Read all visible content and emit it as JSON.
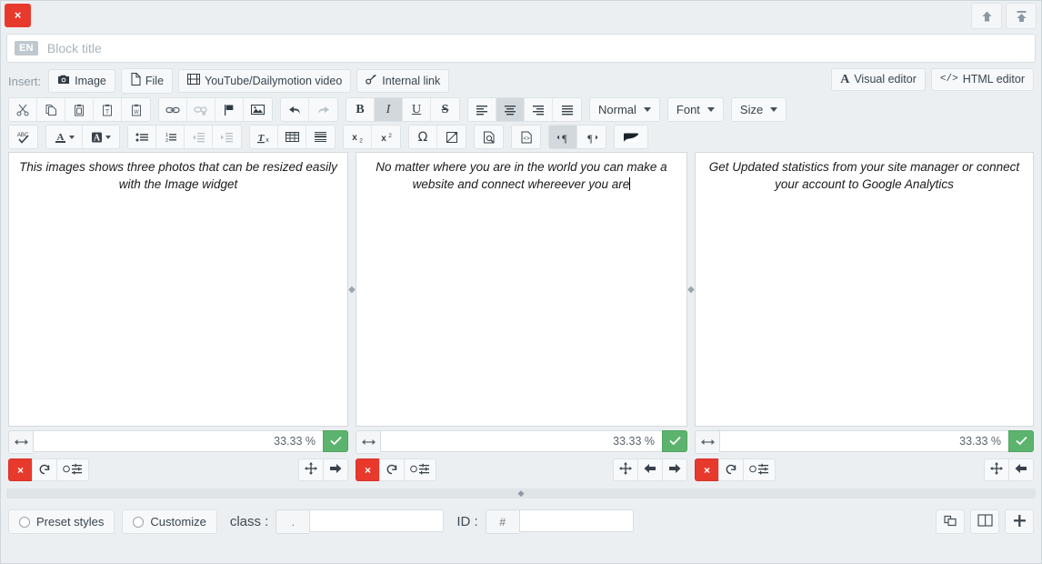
{
  "window": {
    "close_label": "×",
    "move_up_icon": "arrow-up-icon",
    "move_top_icon": "arrow-up-to-line-icon"
  },
  "title_bar": {
    "language_badge": "EN",
    "placeholder": "Block title",
    "value": ""
  },
  "insert_bar": {
    "label": "Insert:",
    "buttons": [
      {
        "label": "Image",
        "icon": "camera-icon"
      },
      {
        "label": "File",
        "icon": "file-icon"
      },
      {
        "label": "YouTube/Dailymotion video",
        "icon": "film-icon"
      },
      {
        "label": "Internal link",
        "icon": "chain-icon"
      }
    ],
    "editor_modes": [
      {
        "label": "Visual editor",
        "icon": "font-a-icon",
        "active": true
      },
      {
        "label": "HTML editor",
        "icon": "code-icon",
        "active": false
      }
    ]
  },
  "toolbar_row1": {
    "group1": [
      {
        "name": "cut",
        "icon": "scissors-icon",
        "active": false,
        "disabled": false
      },
      {
        "name": "copy",
        "icon": "copy-icon",
        "active": false,
        "disabled": false
      },
      {
        "name": "paste",
        "icon": "clipboard-icon",
        "active": false,
        "disabled": false
      },
      {
        "name": "paste-as-text",
        "icon": "clipboard-text-icon",
        "active": false,
        "disabled": false
      },
      {
        "name": "paste-from-word",
        "icon": "clipboard-word-icon",
        "active": false,
        "disabled": false
      }
    ],
    "group2": [
      {
        "name": "link",
        "icon": "link-icon",
        "active": false,
        "disabled": false
      },
      {
        "name": "unlink",
        "icon": "unlink-icon",
        "active": false,
        "disabled": true
      },
      {
        "name": "anchor",
        "icon": "flag-icon",
        "active": false,
        "disabled": false
      },
      {
        "name": "image",
        "icon": "picture-icon",
        "active": false,
        "disabled": false
      }
    ],
    "group3": [
      {
        "name": "undo",
        "icon": "undo-arrow-icon",
        "active": false,
        "disabled": false
      },
      {
        "name": "redo",
        "icon": "redo-arrow-icon",
        "active": false,
        "disabled": true
      }
    ],
    "group4": [
      {
        "name": "bold",
        "icon": "bold-icon",
        "active": false,
        "disabled": false
      },
      {
        "name": "italic",
        "icon": "italic-icon",
        "active": true,
        "disabled": false
      },
      {
        "name": "underline",
        "icon": "underline-icon",
        "active": false,
        "disabled": false
      },
      {
        "name": "strikethrough",
        "icon": "strikethrough-icon",
        "active": false,
        "disabled": false
      }
    ],
    "group5": [
      {
        "name": "align-left",
        "icon": "align-left-icon",
        "active": false,
        "disabled": false
      },
      {
        "name": "align-center",
        "icon": "align-center-icon",
        "active": true,
        "disabled": false
      },
      {
        "name": "align-right",
        "icon": "align-right-icon",
        "active": false,
        "disabled": false
      },
      {
        "name": "align-justify",
        "icon": "align-justify-icon",
        "active": false,
        "disabled": false
      }
    ],
    "selects": [
      {
        "name": "format",
        "label": "Normal"
      },
      {
        "name": "font",
        "label": "Font"
      },
      {
        "name": "size",
        "label": "Size"
      }
    ]
  },
  "toolbar_row2": {
    "group1": [
      {
        "name": "spell-check",
        "icon": "abc-check-icon",
        "active": false,
        "disabled": false
      }
    ],
    "group2": [
      {
        "name": "text-color",
        "icon": "text-color-icon",
        "active": false,
        "disabled": false
      },
      {
        "name": "background-color",
        "icon": "background-color-icon",
        "active": false,
        "disabled": false
      }
    ],
    "group3": [
      {
        "name": "bulleted-list",
        "icon": "bullet-list-icon",
        "active": false,
        "disabled": false
      },
      {
        "name": "numbered-list",
        "icon": "numbered-list-icon",
        "active": false,
        "disabled": false
      },
      {
        "name": "outdent",
        "icon": "outdent-icon",
        "active": false,
        "disabled": true
      },
      {
        "name": "indent",
        "icon": "indent-icon",
        "active": false,
        "disabled": true
      }
    ],
    "group4": [
      {
        "name": "remove-format",
        "icon": "remove-format-icon",
        "active": false,
        "disabled": false
      },
      {
        "name": "table",
        "icon": "table-icon",
        "active": false,
        "disabled": false
      },
      {
        "name": "horizontal-rule",
        "icon": "horizontal-rule-icon",
        "active": false,
        "disabled": false
      }
    ],
    "group5": [
      {
        "name": "subscript",
        "icon": "subscript-icon",
        "active": false,
        "disabled": false
      },
      {
        "name": "superscript",
        "icon": "superscript-icon",
        "active": false,
        "disabled": false
      }
    ],
    "group6": [
      {
        "name": "special-character",
        "icon": "omega-icon",
        "active": false,
        "disabled": false
      },
      {
        "name": "page-break",
        "icon": "page-break-icon",
        "active": false,
        "disabled": false
      }
    ],
    "group7": [
      {
        "name": "preview",
        "icon": "preview-icon",
        "active": false,
        "disabled": false
      }
    ],
    "group8": [
      {
        "name": "source-code",
        "icon": "source-code-icon",
        "active": false,
        "disabled": false
      }
    ],
    "group9": [
      {
        "name": "text-direction-ltr",
        "icon": "paragraph-ltr-icon",
        "active": true,
        "disabled": false
      },
      {
        "name": "text-direction-rtl",
        "icon": "paragraph-rtl-icon",
        "active": false,
        "disabled": false
      }
    ],
    "group10": [
      {
        "name": "maximize",
        "icon": "media-flag-icon",
        "active": false,
        "disabled": false
      }
    ]
  },
  "columns": [
    {
      "text": "This images shows three photos that can be resized easily with the Image widget",
      "has_cursor": false,
      "width_value": "33.33 %",
      "confirm_icon": "check-icon",
      "resize_icon": "resize-horizontal-icon",
      "actions_left": [
        {
          "name": "delete-column",
          "icon": "close-x-icon",
          "label": "×",
          "style": "danger"
        },
        {
          "name": "reset-column",
          "icon": "undo-circle-icon",
          "label": "",
          "style": "default"
        },
        {
          "name": "column-settings",
          "icon": "sliders-icon",
          "label": "",
          "style": "default"
        }
      ],
      "actions_right": [
        {
          "name": "move-column",
          "icon": "move-arrows-icon"
        },
        {
          "name": "move-column-right",
          "icon": "arrow-right-icon"
        }
      ]
    },
    {
      "text": "No matter where you are in the world you can make a website and connect whereever you are",
      "has_cursor": true,
      "width_value": "33.33 %",
      "confirm_icon": "check-icon",
      "resize_icon": "resize-horizontal-icon",
      "actions_left": [
        {
          "name": "delete-column",
          "icon": "close-x-icon",
          "label": "×",
          "style": "danger"
        },
        {
          "name": "reset-column",
          "icon": "undo-circle-icon",
          "label": "",
          "style": "default"
        },
        {
          "name": "column-settings",
          "icon": "sliders-icon",
          "label": "",
          "style": "default"
        }
      ],
      "actions_right": [
        {
          "name": "move-column",
          "icon": "move-arrows-icon"
        },
        {
          "name": "move-column-left",
          "icon": "arrow-left-icon"
        },
        {
          "name": "move-column-right",
          "icon": "arrow-right-icon"
        }
      ]
    },
    {
      "text": "Get Updated statistics from your site manager or connect your account to Google Analytics",
      "has_cursor": false,
      "width_value": "33.33 %",
      "confirm_icon": "check-icon",
      "resize_icon": "resize-horizontal-icon",
      "actions_left": [
        {
          "name": "delete-column",
          "icon": "close-x-icon",
          "label": "×",
          "style": "danger"
        },
        {
          "name": "reset-column",
          "icon": "undo-circle-icon",
          "label": "",
          "style": "default"
        },
        {
          "name": "column-settings",
          "icon": "sliders-icon",
          "label": "",
          "style": "default"
        }
      ],
      "actions_right": [
        {
          "name": "move-column",
          "icon": "move-arrows-icon"
        },
        {
          "name": "move-column-left",
          "icon": "arrow-left-icon"
        }
      ]
    }
  ],
  "footer": {
    "preset_styles_label": "Preset styles",
    "customize_label": "Customize",
    "class_label": "class :",
    "class_prefix": ".",
    "class_value": "",
    "id_label": "ID :",
    "id_prefix": "#",
    "id_value": "",
    "buttons": [
      {
        "name": "duplicate-block",
        "icon": "duplicate-icon"
      },
      {
        "name": "columns-layout",
        "icon": "columns-icon"
      },
      {
        "name": "add-block",
        "icon": "plus-icon"
      }
    ]
  }
}
